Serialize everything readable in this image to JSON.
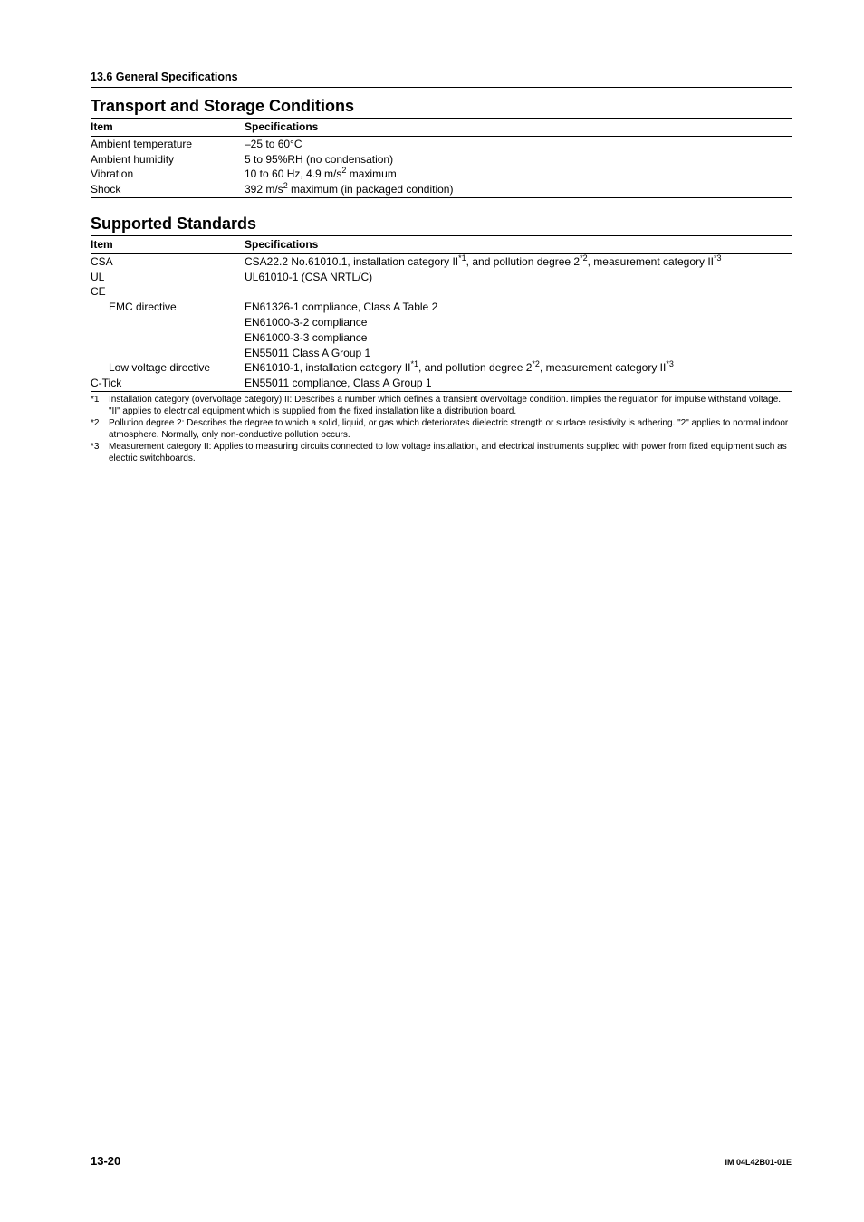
{
  "header": "13.6  General Specifications",
  "sections": [
    {
      "title": "Transport and Storage Conditions",
      "head_item": "Item",
      "head_spec": "Specifications",
      "rows": [
        {
          "item_html": "Ambient temperature",
          "spec_html": "–25 to 60°C"
        },
        {
          "item_html": "Ambient humidity",
          "spec_html": "5 to 95%RH (no condensation)"
        },
        {
          "item_html": "Vibration",
          "spec_html": "10 to 60 Hz, 4.9 m/s<sup>2</sup> maximum"
        },
        {
          "item_html": "Shock",
          "spec_html": "392 m/s<sup>2</sup> maximum (in packaged condition)"
        }
      ]
    },
    {
      "title": "Supported Standards",
      "head_item": "Item",
      "head_spec": "Specifications",
      "rows": [
        {
          "item_html": "CSA",
          "spec_html": "CSA22.2 No.61010.1, installation category II<sup>*1</sup>, and pollution degree 2<sup>*2</sup>, measurement category II<sup>*3</sup>"
        },
        {
          "item_html": "UL",
          "spec_html": "UL61010-1 (CSA NRTL/C)"
        },
        {
          "item_html": "CE",
          "spec_html": ""
        },
        {
          "item_html": "EMC directive",
          "indent": true,
          "spec_html": "EN61326-1 compliance, Class A Table 2"
        },
        {
          "item_html": "",
          "spec_html": "EN61000-3-2 compliance"
        },
        {
          "item_html": "",
          "spec_html": "EN61000-3-3 compliance"
        },
        {
          "item_html": "",
          "spec_html": "EN55011 Class A Group 1"
        },
        {
          "item_html": "Low voltage directive",
          "indent": true,
          "spec_html": "EN61010-1, installation category II<sup>*1</sup>, and pollution degree 2<sup>*2</sup>, measurement category II<sup>*3</sup>"
        },
        {
          "item_html": "C-Tick",
          "spec_html": "EN55011 compliance, Class A Group 1"
        }
      ]
    }
  ],
  "footnotes": [
    {
      "marker": "*1",
      "text": "Installation category (overvoltage category) II: Describes a number which defines a transient overvoltage condition. Iimplies the regulation for impulse withstand voltage. \"II\" applies to electrical equipment which is supplied from the fixed installation like a distribution board."
    },
    {
      "marker": "*2",
      "text": "Pollution degree 2: Describes the degree to which a solid, liquid, or gas which deteriorates dielectric strength or surface resistivity is adhering. \"2\" applies to normal indoor atmosphere. Normally, only non-conductive pollution occurs."
    },
    {
      "marker": "*3",
      "text": "Measurement category II: Applies to measuring circuits connected to low voltage installation, and electrical instruments supplied with power from fixed equipment such as electric switchboards."
    }
  ],
  "footer": {
    "page": "13-20",
    "doc_id": "IM 04L42B01-01E"
  }
}
